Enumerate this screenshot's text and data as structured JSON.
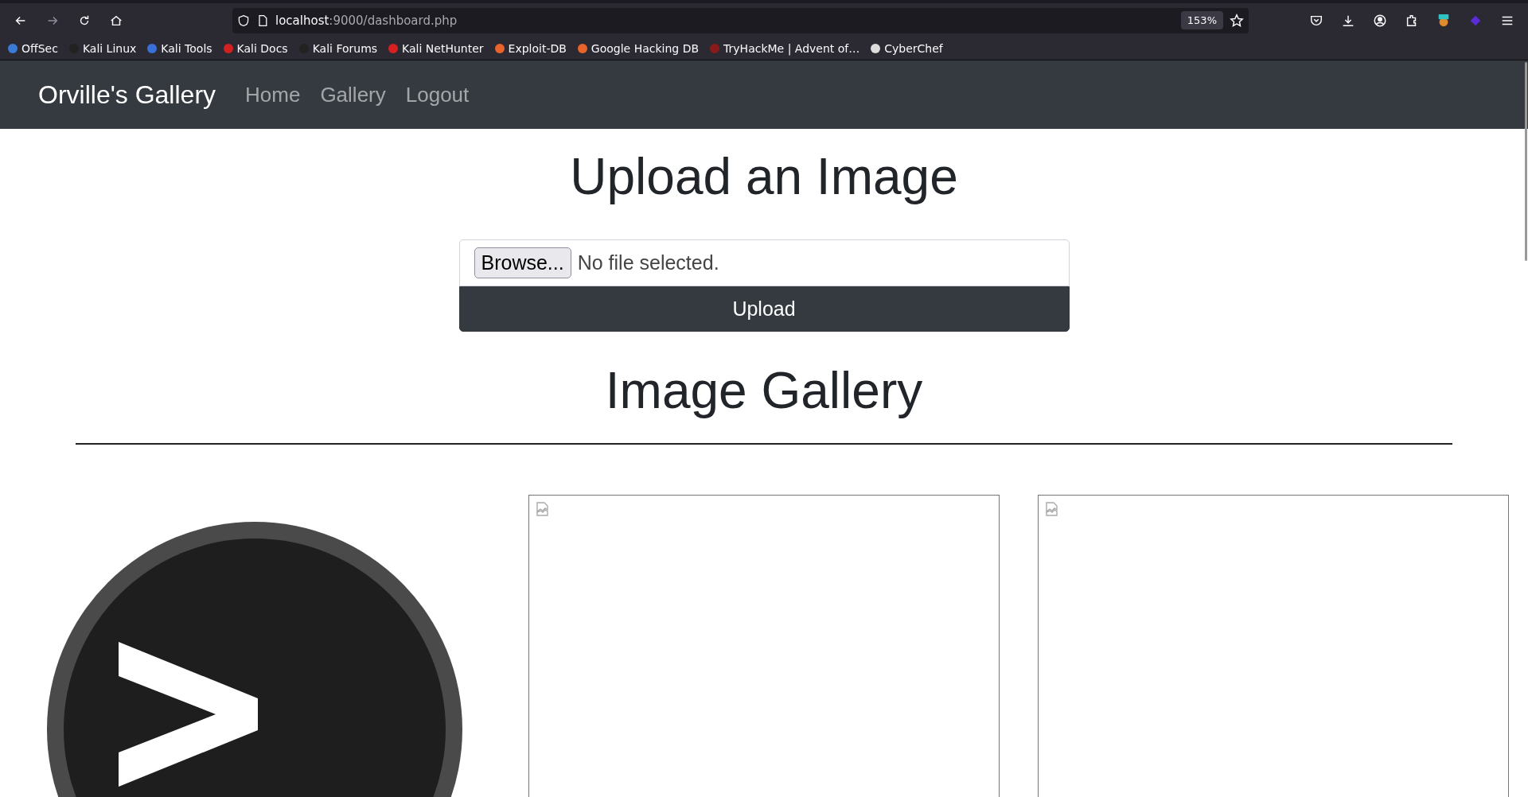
{
  "browser": {
    "url_host": "localhost",
    "url_path": ":9000/dashboard.php",
    "zoom": "153%",
    "bookmarks": [
      {
        "label": "OffSec",
        "color": "#3b7bd8"
      },
      {
        "label": "Kali Linux",
        "color": "#222222"
      },
      {
        "label": "Kali Tools",
        "color": "#3a6fd8"
      },
      {
        "label": "Kali Docs",
        "color": "#d32020"
      },
      {
        "label": "Kali Forums",
        "color": "#222222"
      },
      {
        "label": "Kali NetHunter",
        "color": "#d82020"
      },
      {
        "label": "Exploit-DB",
        "color": "#e8642a"
      },
      {
        "label": "Google Hacking DB",
        "color": "#e8642a"
      },
      {
        "label": "TryHackMe | Advent of…",
        "color": "#8a1a1a"
      },
      {
        "label": "CyberChef",
        "color": "#dddddd"
      }
    ]
  },
  "navbar": {
    "brand": "Orville's Gallery",
    "links": [
      "Home",
      "Gallery",
      "Logout"
    ]
  },
  "upload": {
    "title": "Upload an Image",
    "browse_button": "Browse...",
    "file_status": "No file selected.",
    "submit": "Upload"
  },
  "gallery": {
    "title": "Image Gallery",
    "items": [
      {
        "kind": "terminal-logo"
      },
      {
        "kind": "broken-image"
      },
      {
        "kind": "broken-image"
      }
    ]
  }
}
